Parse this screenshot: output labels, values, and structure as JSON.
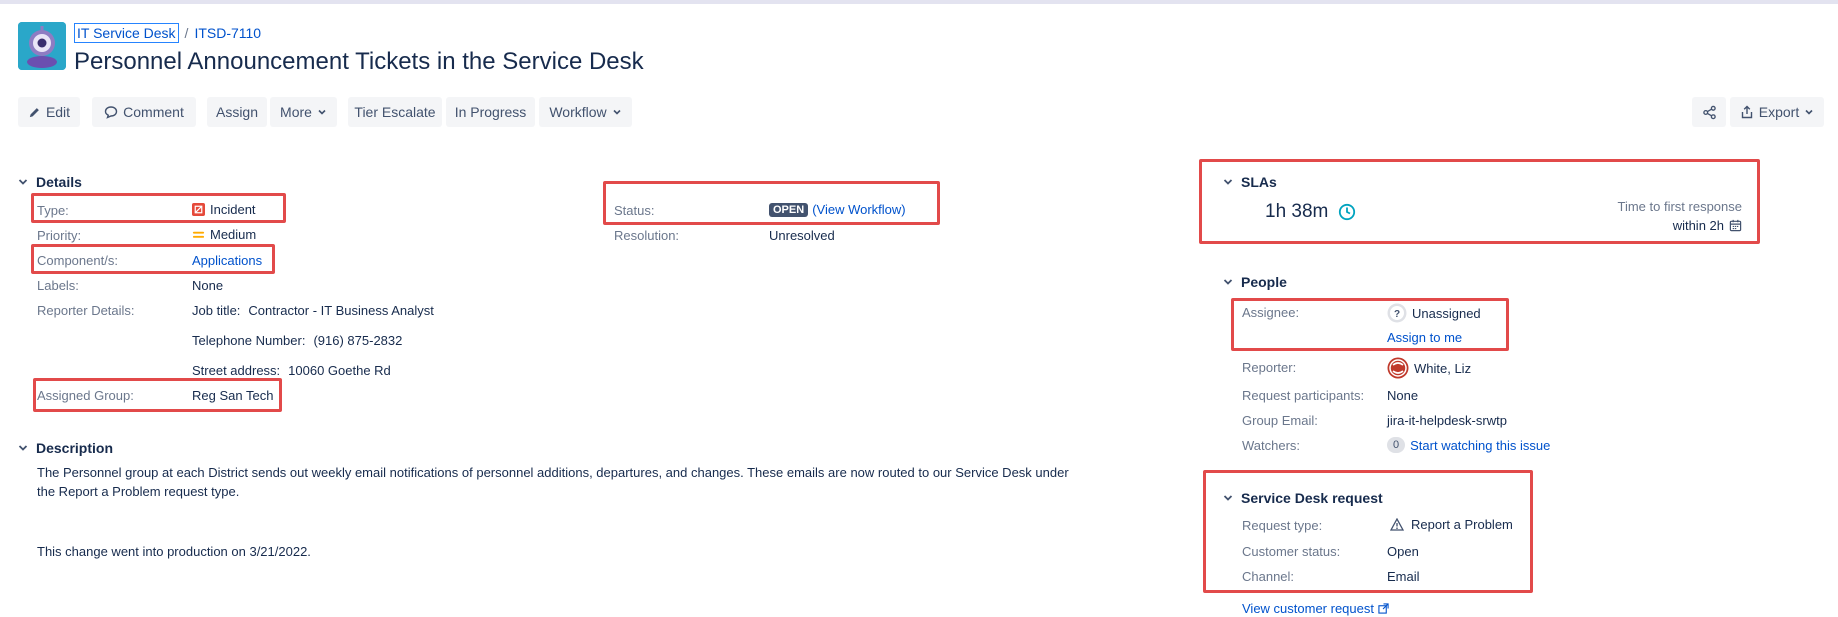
{
  "header": {
    "project_link": "IT Service Desk",
    "separator": "/",
    "issue_key": "ITSD-7110",
    "title": "Personnel Announcement Tickets in the Service Desk"
  },
  "toolbar": {
    "edit": "Edit",
    "comment": "Comment",
    "assign": "Assign",
    "more": "More",
    "tier_escalate": "Tier Escalate",
    "in_progress": "In Progress",
    "workflow": "Workflow",
    "export": "Export"
  },
  "details": {
    "heading": "Details",
    "type_label": "Type:",
    "type_value": "Incident",
    "priority_label": "Priority:",
    "priority_value": "Medium",
    "components_label": "Component/s:",
    "components_value": "Applications",
    "labels_label": "Labels:",
    "labels_value": "None",
    "reporter_details_label": "Reporter Details:",
    "job_title_label": "Job title:",
    "job_title_value": "Contractor - IT Business Analyst",
    "telephone_label": "Telephone Number:",
    "telephone_value": "(916) 875-2832",
    "street_label": "Street address:",
    "street_value": "10060 Goethe Rd",
    "assigned_group_label": "Assigned Group:",
    "assigned_group_value": "Reg San Tech",
    "status_label": "Status:",
    "status_value": "OPEN",
    "view_workflow": "(View Workflow)",
    "resolution_label": "Resolution:",
    "resolution_value": "Unresolved"
  },
  "description": {
    "heading": "Description",
    "para1_line1": "The Personnel group at each District sends out weekly email notifications of personnel additions, departures, and changes.  These emails are now routed to our Service Desk under",
    "para1_line2": "the Report a Problem request type.",
    "para2": "This change went into production on 3/21/2022."
  },
  "slas": {
    "heading": "SLAs",
    "time_remaining": "1h 38m",
    "goal_name": "Time to first response",
    "goal_target": "within 2h"
  },
  "people": {
    "heading": "People",
    "assignee_label": "Assignee:",
    "assignee_value": "Unassigned",
    "assign_to_me": "Assign to me",
    "reporter_label": "Reporter:",
    "reporter_value": "White, Liz",
    "participants_label": "Request participants:",
    "participants_value": "None",
    "group_email_label": "Group Email:",
    "group_email_value": "jira-it-helpdesk-srwtp",
    "watchers_label": "Watchers:",
    "watchers_count": "0",
    "start_watching": "Start watching this issue"
  },
  "service_desk": {
    "heading": "Service Desk request",
    "request_type_label": "Request type:",
    "request_type_value": "Report a Problem",
    "customer_status_label": "Customer status:",
    "customer_status_value": "Open",
    "channel_label": "Channel:",
    "channel_value": "Email",
    "view_customer_request": "View customer request"
  },
  "colors": {
    "link": "#0052cc",
    "annotation_red": "#e24a4a",
    "incident_red": "#e5493a",
    "priority_orange": "#ffab00",
    "sla_teal": "#00a3bf"
  }
}
